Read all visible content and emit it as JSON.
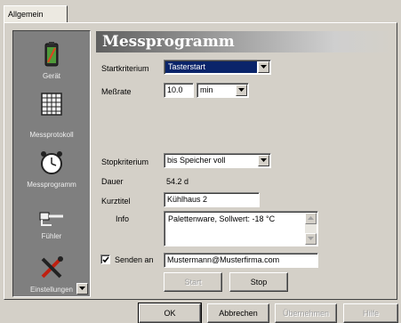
{
  "tabs": [
    {
      "label": "Allgemein"
    }
  ],
  "sidebar": {
    "items": [
      {
        "label": "Gerät",
        "icon": "battery-device-icon"
      },
      {
        "label": "Messprotokoll",
        "icon": "grid-table-icon"
      },
      {
        "label": "Messprogramm",
        "icon": "alarm-clock-icon"
      },
      {
        "label": "Fühler",
        "icon": "probe-sensor-icon"
      },
      {
        "label": "Einstellungen",
        "icon": "tools-settings-icon"
      }
    ]
  },
  "main": {
    "title": "Messprogramm",
    "startkriterium": {
      "label": "Startkriterium",
      "value": "Tasterstart"
    },
    "messrate": {
      "label": "Meßrate",
      "value": "10.0",
      "unit": "min"
    },
    "stopkriterium": {
      "label": "Stopkriterium",
      "value": "bis Speicher voll"
    },
    "dauer": {
      "label": "Dauer",
      "value": "54.2 d"
    },
    "kurztitel": {
      "label": "Kurztitel",
      "value": "Kühlhaus 2"
    },
    "info": {
      "label": "Info",
      "value": "Palettenware, Sollwert: -18 °C"
    },
    "senden": {
      "label": "Senden an",
      "checked": true,
      "value": "Mustermann@Musterfirma.com"
    },
    "start_label": "Start",
    "stop_label": "Stop"
  },
  "footer": {
    "ok": "OK",
    "abbrechen": "Abbrechen",
    "uebernehmen": "Übernehmen",
    "hilfe": "Hilfe"
  }
}
